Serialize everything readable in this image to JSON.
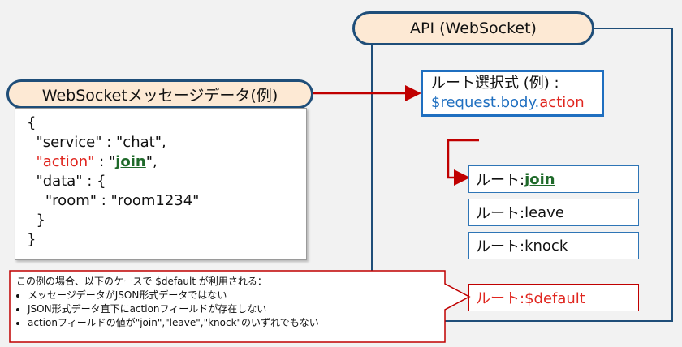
{
  "api_title": "API (WebSocket)",
  "msg_title": "WebSocketメッセージデータ(例)",
  "code": {
    "open_brace": "{",
    "service_key": "\"service\"",
    "service_sep": " : ",
    "service_val": "\"chat\",",
    "action_key": "\"action\"",
    "action_sep": " : ",
    "action_q1": "\"",
    "action_val": "join",
    "action_q2": "\",",
    "data_key": "\"data\"",
    "data_sep": " : {",
    "room_key": "\"room\"",
    "room_sep": " : ",
    "room_val": "\"room1234\"",
    "inner_close": "}",
    "close_brace": "}"
  },
  "selector": {
    "line1": "ルート選択式 (例) :",
    "expr_blue": "$request.body.",
    "expr_red": "action"
  },
  "routes": [
    {
      "prefix": "ルート: ",
      "value": "join"
    },
    {
      "prefix": "ルート: ",
      "value": "leave"
    },
    {
      "prefix": "ルート: ",
      "value": "knock"
    }
  ],
  "default_route": "ルート:$default",
  "note": {
    "title": "この例の場合、以下のケースで $default が利用される：",
    "items": [
      "メッセージデータがJSON形式データではない",
      "JSON形式データ直下にactionフィールドが存在しない",
      "actionフィールドの値が\"join\",\"leave\",\"knock\"のいずれでもない"
    ]
  },
  "colors": {
    "navy": "#1f4e79",
    "red": "#c00000",
    "blue": "#1f6fc0",
    "pill_fill": "#fde9d4"
  }
}
